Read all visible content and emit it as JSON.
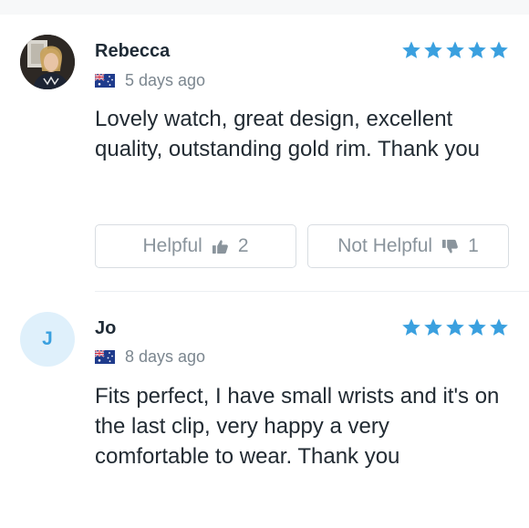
{
  "colors": {
    "star": "#3aa0df",
    "text": "#1f2b36",
    "muted": "#7b868f",
    "button_border": "#d8dde2"
  },
  "reviews": [
    {
      "reviewer": "Rebecca",
      "avatar_type": "photo",
      "country_flag": "australia-flag",
      "date": "5 days ago",
      "rating": 5,
      "text": "Lovely watch, great design, excellent quality, outstanding gold rim. Thank you",
      "helpful_label": "Helpful",
      "helpful_count": "2",
      "not_helpful_label": "Not Helpful",
      "not_helpful_count": "1"
    },
    {
      "reviewer": "Jo",
      "avatar_type": "initial",
      "avatar_initial": "J",
      "country_flag": "australia-flag",
      "date": "8 days ago",
      "rating": 5,
      "text": "Fits perfect, I have small wrists and it's on the last clip, very happy a very comfortable to wear. Thank you"
    }
  ]
}
